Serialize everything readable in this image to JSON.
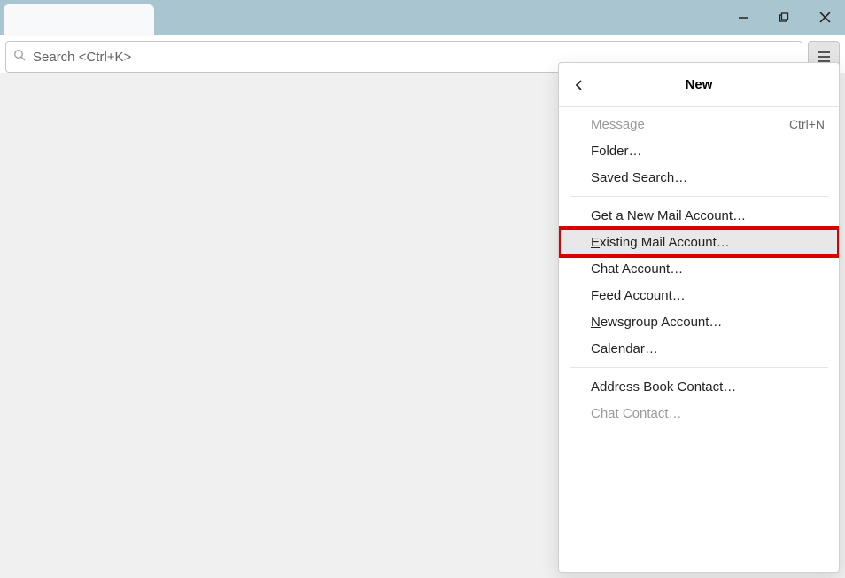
{
  "search": {
    "placeholder": "Search <Ctrl+K>"
  },
  "menu": {
    "title": "New",
    "items": [
      {
        "label": "Message",
        "shortcut": "Ctrl+N",
        "disabled": true
      },
      {
        "label": "Folder…"
      },
      {
        "label": "Saved Search…"
      }
    ],
    "items2": [
      {
        "label": "Get a New Mail Account…"
      },
      {
        "label_pre": "",
        "ak": "E",
        "label_post": "xisting Mail Account…",
        "highlighted": true
      },
      {
        "label": "Chat Account…"
      },
      {
        "label_pre": "Fee",
        "ak": "d",
        "label_post": " Account…"
      },
      {
        "label_pre": "",
        "ak": "N",
        "label_post": "ewsgroup Account…"
      },
      {
        "label": "Calendar…"
      }
    ],
    "items3": [
      {
        "label": "Address Book Contact…"
      },
      {
        "label": "Chat Contact…",
        "disabled": true
      }
    ]
  }
}
